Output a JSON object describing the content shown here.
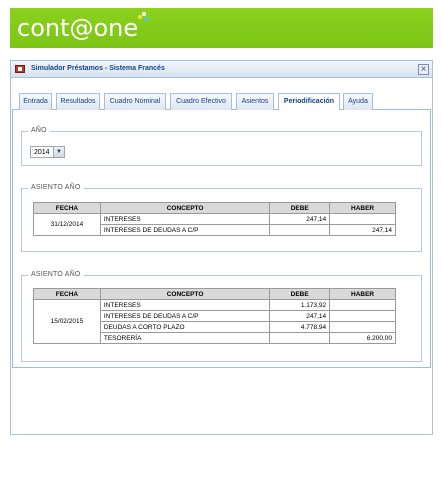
{
  "logo": {
    "text": "cont@one"
  },
  "window": {
    "title": "Simulador Préstamos - Sistema Francés"
  },
  "tabs": [
    {
      "label": "Entrada",
      "active": false
    },
    {
      "label": "Resultados",
      "active": false
    },
    {
      "label": "Cuadro Nominal",
      "active": false
    },
    {
      "label": "Cuadro Efectivo",
      "active": false
    },
    {
      "label": "Asientos",
      "active": false
    },
    {
      "label": "Periodificación",
      "active": true
    },
    {
      "label": "Ayuda",
      "active": false
    }
  ],
  "year_group": {
    "legend": "AÑO",
    "selected": "2014"
  },
  "columns": {
    "fecha": "FECHA",
    "concepto": "CONCEPTO",
    "debe": "DEBE",
    "haber": "HABER"
  },
  "entry1": {
    "legend": "ASIENTO AÑO",
    "date": "31/12/2014",
    "rows": [
      {
        "concepto": "INTERESES",
        "debe": "247,14",
        "haber": ""
      },
      {
        "concepto": "INTERESES DE DEUDAS A C/P",
        "debe": "",
        "haber": "247,14"
      }
    ]
  },
  "entry2": {
    "legend": "ASIENTO AÑO",
    "date": "15/02/2015",
    "rows": [
      {
        "concepto": "INTERESES",
        "debe": "1.173,92",
        "haber": ""
      },
      {
        "concepto": "INTERESES DE DEUDAS A C/P",
        "debe": "247,14",
        "haber": ""
      },
      {
        "concepto": "DEUDAS A CORTO PLAZO",
        "debe": "4.778,94",
        "haber": ""
      },
      {
        "concepto": "TESORERÍA",
        "debe": "",
        "haber": "6.200,00"
      }
    ]
  },
  "colors": {
    "brand_green": "#7cc416",
    "window_border": "#a8c0da",
    "title_text": "#15428b"
  }
}
